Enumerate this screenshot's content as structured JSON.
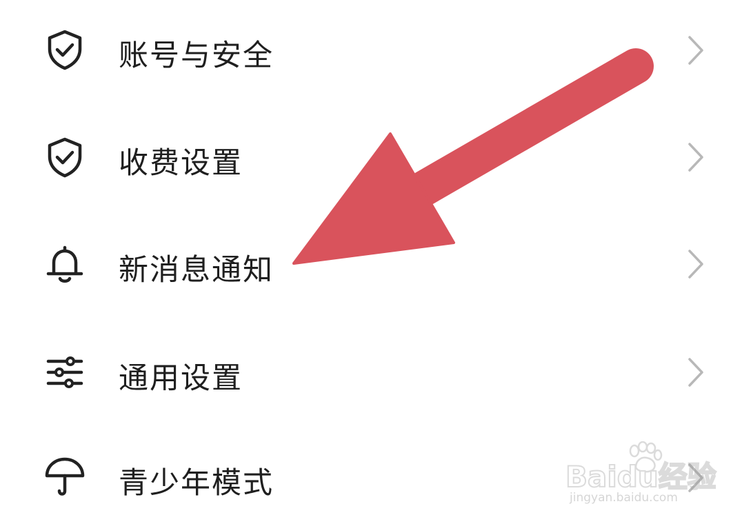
{
  "menu": {
    "items": [
      {
        "label": "账号与安全",
        "icon": "shield-check-icon"
      },
      {
        "label": "收费设置",
        "icon": "shield-check-icon"
      },
      {
        "label": "新消息通知",
        "icon": "bell-icon"
      },
      {
        "label": "通用设置",
        "icon": "sliders-icon"
      },
      {
        "label": "青少年模式",
        "icon": "umbrella-icon"
      }
    ]
  },
  "annotation": {
    "arrow_color": "#d9535c",
    "points_to": "新消息通知"
  },
  "watermark": {
    "brand": "Baidu经验",
    "url": "jingyan.baidu.com"
  }
}
